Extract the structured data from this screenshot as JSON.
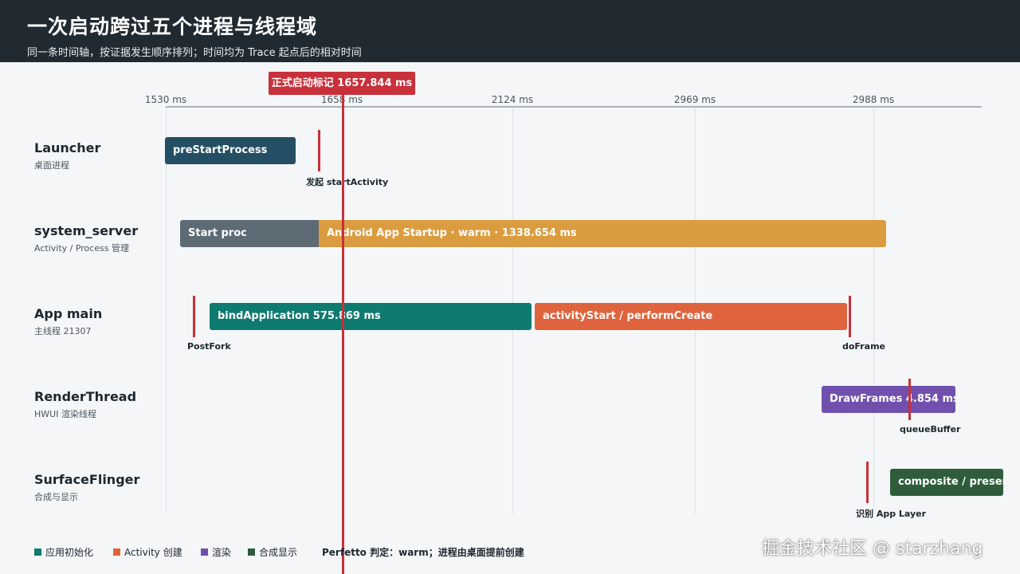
{
  "header": {
    "title": "一次启动跨过五个进程与线程域",
    "subtitle": "同一条时间轴，按证据发生顺序排列；时间均为 Trace 起点后的相对时间"
  },
  "axis": {
    "ticks": [
      "1530 ms",
      "1658 ms",
      "2124 ms",
      "2969 ms",
      "2988 ms"
    ]
  },
  "start_marker": {
    "label": "正式启动标记 1657.844 ms"
  },
  "lanes": [
    {
      "title": "Launcher",
      "subtitle": "桌面进程",
      "bars": [
        {
          "label": "preStartProcess",
          "color": "#244e63"
        }
      ],
      "markers": [
        {
          "label": "发起 startActivity"
        }
      ]
    },
    {
      "title": "system_server",
      "subtitle": "Activity / Process 管理",
      "bars": [
        {
          "label": "Start proc",
          "color": "#5d6b75"
        },
        {
          "label": "Android App Startup · warm · 1338.654 ms",
          "color": "#db9c40"
        }
      ],
      "markers": []
    },
    {
      "title": "App main",
      "subtitle": "主线程 21307",
      "bars": [
        {
          "label": "bindApplication 575.869 ms",
          "color": "#0f7a6f"
        },
        {
          "label": "activityStart / performCreate",
          "color": "#df643d"
        }
      ],
      "markers": [
        {
          "label": "PostFork"
        },
        {
          "label": "doFrame"
        }
      ]
    },
    {
      "title": "RenderThread",
      "subtitle": "HWUI 渲染线程",
      "bars": [
        {
          "label": "DrawFrames 4.854 ms",
          "color": "#7150ad"
        }
      ],
      "markers": [
        {
          "label": "queueBuffer"
        }
      ]
    },
    {
      "title": "SurfaceFlinger",
      "subtitle": "合成与显示",
      "bars": [
        {
          "label": "composite / present",
          "color": "#2f5d3c"
        }
      ],
      "markers": [
        {
          "label": "识别 App Layer"
        }
      ]
    }
  ],
  "legend": {
    "items": [
      {
        "label": "应用初始化",
        "color": "#0f7a6f"
      },
      {
        "label": "Activity 创建",
        "color": "#df643d"
      },
      {
        "label": "渲染",
        "color": "#7150ad"
      },
      {
        "label": "合成显示",
        "color": "#2f5d3c"
      }
    ],
    "note": "Perfetto 判定：warm；进程由桌面提前创建"
  },
  "watermark": "掘金技术社区 @ starzhang",
  "colors": {
    "marker": "#c8303a",
    "header_bg": "#222a31"
  }
}
